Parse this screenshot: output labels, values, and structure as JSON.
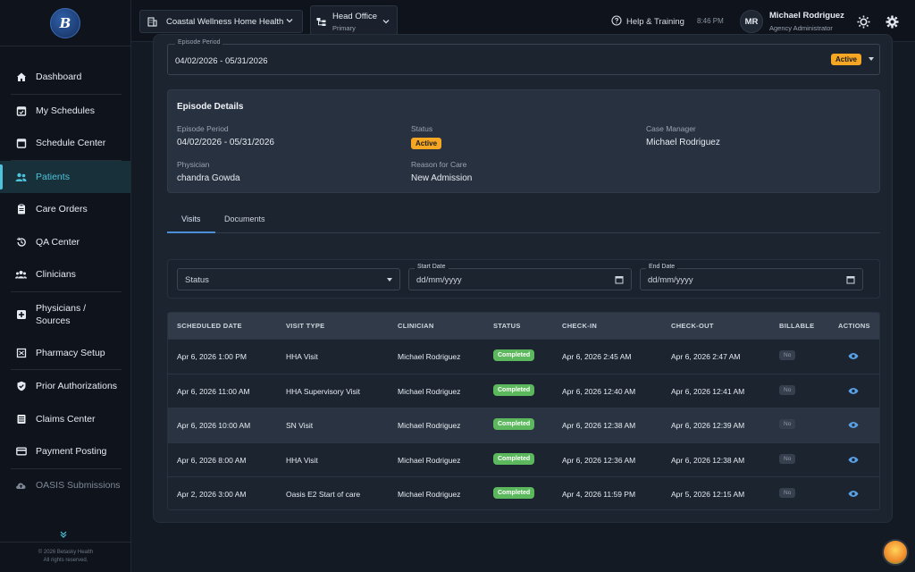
{
  "sidebar": {
    "items": [
      {
        "label": "Dashboard",
        "icon": "home-icon"
      },
      {
        "label": "My Schedules",
        "icon": "calendar-check-icon"
      },
      {
        "label": "Schedule Center",
        "icon": "calendar-icon"
      },
      {
        "label": "Patients",
        "icon": "users-icon",
        "active": true
      },
      {
        "label": "Care Orders",
        "icon": "clipboard-icon"
      },
      {
        "label": "QA Center",
        "icon": "history-icon"
      },
      {
        "label": "Clinicians",
        "icon": "group-icon"
      },
      {
        "label": "Physicians / Sources",
        "icon": "medical-plus-icon"
      },
      {
        "label": "Pharmacy Setup",
        "icon": "pharmacy-icon"
      },
      {
        "label": "Prior Authorizations",
        "icon": "shield-check-icon"
      },
      {
        "label": "Claims Center",
        "icon": "list-doc-icon"
      },
      {
        "label": "Payment Posting",
        "icon": "credit-card-icon"
      },
      {
        "label": "OASIS Submissions",
        "icon": "cloud-upload-icon"
      }
    ],
    "footer_line1": "© 2026 Betasky Health",
    "footer_line2": "All rights reserved."
  },
  "topbar": {
    "agency": "Coastal Wellness Home Health",
    "office_name": "Head Office",
    "office_type": "Primary",
    "help_label": "Help & Training",
    "time": "8:46 PM",
    "user_initials": "MR",
    "user_name": "Michael Rodriguez",
    "user_role": "Agency Administrator"
  },
  "episode_select": {
    "label": "Episode Period",
    "value": "04/02/2026 - 05/31/2026",
    "status": "Active"
  },
  "details": {
    "title": "Episode Details",
    "period_label": "Episode Period",
    "period_value": "04/02/2026 - 05/31/2026",
    "status_label": "Status",
    "status_value": "Active",
    "case_manager_label": "Case Manager",
    "case_manager_value": "Michael Rodriguez",
    "physician_label": "Physician",
    "physician_value": "chandra Gowda",
    "reason_label": "Reason for Care",
    "reason_value": "New Admission"
  },
  "tabs": [
    "Visits",
    "Documents"
  ],
  "filters": {
    "status_placeholder": "Status",
    "start_label": "Start Date",
    "start_placeholder": "dd/mm/yyyy",
    "end_label": "End Date",
    "end_placeholder": "dd/mm/yyyy"
  },
  "table": {
    "headers": [
      "SCHEDULED DATE",
      "VISIT TYPE",
      "CLINICIAN",
      "STATUS",
      "CHECK-IN",
      "CHECK-OUT",
      "BILLABLE",
      "ACTIONS"
    ],
    "rows": [
      {
        "date": "Apr 6, 2026 1:00 PM",
        "type": "HHA Visit",
        "clinician": "Michael Rodriguez",
        "status": "Completed",
        "checkin": "Apr 6, 2026 2:45 AM",
        "checkout": "Apr 6, 2026 2:47 AM",
        "billable": "No"
      },
      {
        "date": "Apr 6, 2026 11:00 AM",
        "type": "HHA Supervisory Visit",
        "clinician": "Michael Rodriguez",
        "status": "Completed",
        "checkin": "Apr 6, 2026 12:40 AM",
        "checkout": "Apr 6, 2026 12:41 AM",
        "billable": "No"
      },
      {
        "date": "Apr 6, 2026 10:00 AM",
        "type": "SN Visit",
        "clinician": "Michael Rodriguez",
        "status": "Completed",
        "checkin": "Apr 6, 2026 12:38 AM",
        "checkout": "Apr 6, 2026 12:39 AM",
        "billable": "No"
      },
      {
        "date": "Apr 6, 2026 8:00 AM",
        "type": "HHA Visit",
        "clinician": "Michael Rodriguez",
        "status": "Completed",
        "checkin": "Apr 6, 2026 12:36 AM",
        "checkout": "Apr 6, 2026 12:38 AM",
        "billable": "No"
      },
      {
        "date": "Apr 2, 2026 3:00 AM",
        "type": "Oasis E2 Start of care",
        "clinician": "Michael Rodriguez",
        "status": "Completed",
        "checkin": "Apr 4, 2026 11:59 PM",
        "checkout": "Apr 5, 2026 12:15 AM",
        "billable": "No"
      }
    ]
  },
  "colors": {
    "accent": "#4fc3dc",
    "active_badge": "#f5a623",
    "completed": "#5cb85c",
    "eye_icon": "#5aa2e8"
  }
}
